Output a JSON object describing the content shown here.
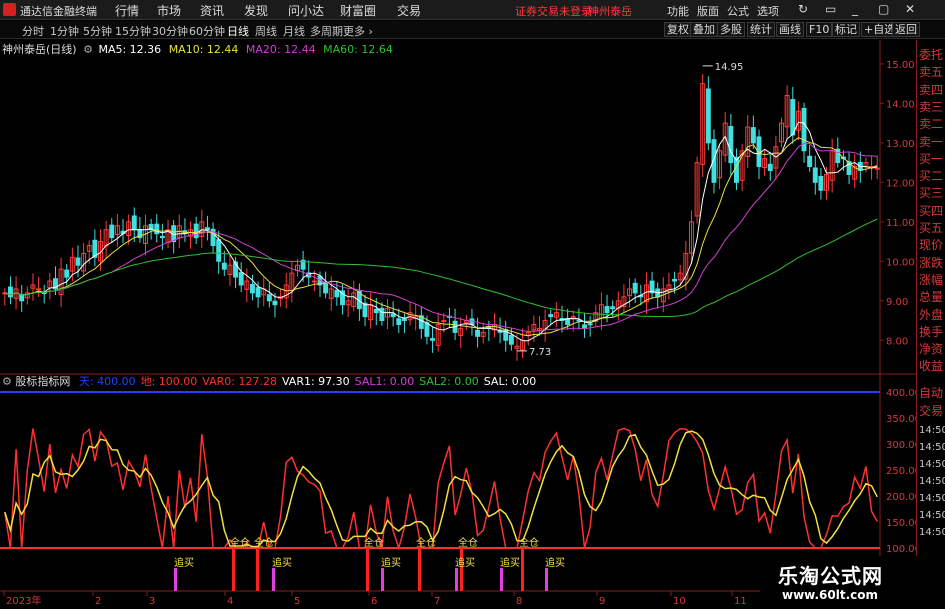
{
  "menubar": {
    "app_name": "通达信金融终端",
    "items": [
      "行情",
      "市场",
      "资讯",
      "发现",
      "问小达",
      "财富圈",
      "交易"
    ],
    "login_warning": "证券交易未登录",
    "stock_name": "神州泰岳",
    "right_buttons": [
      "功能",
      "版面",
      "公式",
      "选项"
    ],
    "window_controls": [
      "↻",
      "▭",
      "_",
      "▢",
      "✕"
    ]
  },
  "periodbar": {
    "periods": [
      "分时",
      "1分钟",
      "5分钟",
      "15分钟",
      "30分钟",
      "60分钟",
      "日线",
      "周线",
      "月线",
      "多周期",
      "更多 ›"
    ],
    "active_index": 6,
    "right_buttons": [
      "复权",
      "叠加",
      "多股",
      "统计",
      "画线",
      "F10",
      "标记",
      "+自选",
      "返回"
    ]
  },
  "main_info": {
    "title": "神州泰岳(日线)",
    "ma5_label": "MA5: 12.36",
    "ma10_label": "MA10: 12.44",
    "ma20_label": "MA20: 12.44",
    "ma60_label": "MA60: 12.64",
    "colors": {
      "ma5": "#ffffff",
      "ma10": "#e8e040",
      "ma20": "#d040d0",
      "ma60": "#30c030"
    }
  },
  "indicator_info": {
    "title": "股标指标网",
    "items": [
      {
        "text": "天: 400.00",
        "color": "#2040ff"
      },
      {
        "text": "地: 100.00",
        "color": "#ff3030"
      },
      {
        "text": "VAR0: 127.28",
        "color": "#ff3030"
      },
      {
        "text": "VAR1: 97.30",
        "color": "#ffffff"
      },
      {
        "text": "SAL1: 0.00",
        "color": "#d040d0"
      },
      {
        "text": "SAL2: 0.00",
        "color": "#30c030"
      },
      {
        "text": "SAL: 0.00",
        "color": "#ffffff"
      }
    ]
  },
  "chart_data": {
    "type": "candlestick",
    "price_axis": {
      "min": 7.5,
      "max": 15.2,
      "ticks": [
        "15.00",
        "14.00",
        "13.00",
        "12.00",
        "11.00",
        "10.00",
        "9.00",
        "8.00"
      ]
    },
    "annotations": {
      "high_label": "14.95",
      "low_label": "7.73"
    },
    "x_tick_labels": [
      "2023年",
      "2",
      "3",
      "4",
      "5",
      "6",
      "7",
      "8",
      "9",
      "10",
      "11"
    ],
    "closes": [
      9.2,
      9.1,
      9.3,
      9.0,
      9.2,
      9.4,
      9.3,
      9.2,
      9.5,
      9.3,
      9.8,
      9.6,
      10.1,
      9.9,
      10.2,
      10.4,
      10.1,
      10.5,
      10.8,
      10.6,
      10.9,
      10.7,
      11.0,
      10.8,
      10.6,
      10.9,
      10.8,
      10.7,
      10.6,
      10.8,
      10.5,
      10.9,
      10.7,
      10.8,
      10.6,
      11.0,
      10.8,
      10.4,
      10.0,
      9.8,
      9.9,
      9.6,
      9.4,
      9.5,
      9.2,
      9.1,
      9.3,
      9.0,
      8.9,
      9.1,
      9.4,
      9.7,
      9.9,
      9.8,
      9.6,
      9.5,
      9.4,
      9.2,
      9.3,
      9.1,
      8.9,
      9.0,
      9.2,
      8.8,
      8.6,
      8.9,
      8.7,
      8.5,
      8.8,
      8.6,
      8.4,
      8.5,
      8.7,
      8.6,
      8.3,
      8.1,
      8.0,
      8.4,
      8.5,
      8.6,
      8.2,
      8.3,
      8.5,
      8.4,
      8.1,
      8.2,
      8.3,
      8.4,
      8.2,
      8.0,
      7.9,
      7.85,
      8.0,
      8.2,
      8.4,
      8.3,
      8.5,
      8.6,
      8.7,
      8.5,
      8.4,
      8.6,
      8.5,
      8.3,
      8.4,
      8.7,
      8.9,
      8.7,
      8.8,
      9.0,
      9.1,
      9.3,
      9.2,
      9.1,
      9.4,
      9.2,
      9.1,
      9.3,
      9.4,
      9.5,
      9.7,
      10.2,
      11.0,
      12.5,
      14.5,
      13.0,
      12.0,
      12.8,
      13.5,
      12.5,
      12.0,
      12.8,
      13.4,
      13.0,
      12.4,
      12.6,
      12.3,
      12.9,
      13.5,
      14.2,
      13.2,
      13.8,
      12.8,
      12.4,
      12.0,
      11.8,
      12.2,
      12.8,
      12.5,
      12.6,
      12.2,
      12.4,
      12.3,
      12.5,
      12.4,
      12.36
    ],
    "indicator": {
      "name": "股标指标网",
      "axis_ticks": [
        "400.00",
        "350.00",
        "300.00",
        "250.00",
        "200.00",
        "150.00",
        "100.00"
      ],
      "buy_labels": [
        "追买",
        "追买",
        "追买",
        "追买",
        "追买",
        "追买"
      ],
      "full_position_labels": [
        "全仓",
        "全仓",
        "全仓",
        "全仓",
        "全仓",
        "全仓"
      ],
      "side_labels": [
        "自动",
        "交易"
      ]
    }
  },
  "right_panel": {
    "items": [
      "委托",
      "卖五",
      "卖四",
      "卖三",
      "卖二",
      "卖一",
      "买一",
      "买二",
      "买三",
      "买四",
      "买五",
      "现价",
      "涨跌",
      "涨幅",
      "总量",
      "外盘",
      "换手",
      "净资",
      "收益"
    ],
    "lower_items": [
      "自动",
      "交易"
    ],
    "time_items": [
      "14:50",
      "14:50",
      "14:50",
      "14:50",
      "14:50",
      "14:50",
      "14:50"
    ]
  },
  "watermark": {
    "title": "乐淘公式网",
    "url": "www.60lt.com"
  }
}
